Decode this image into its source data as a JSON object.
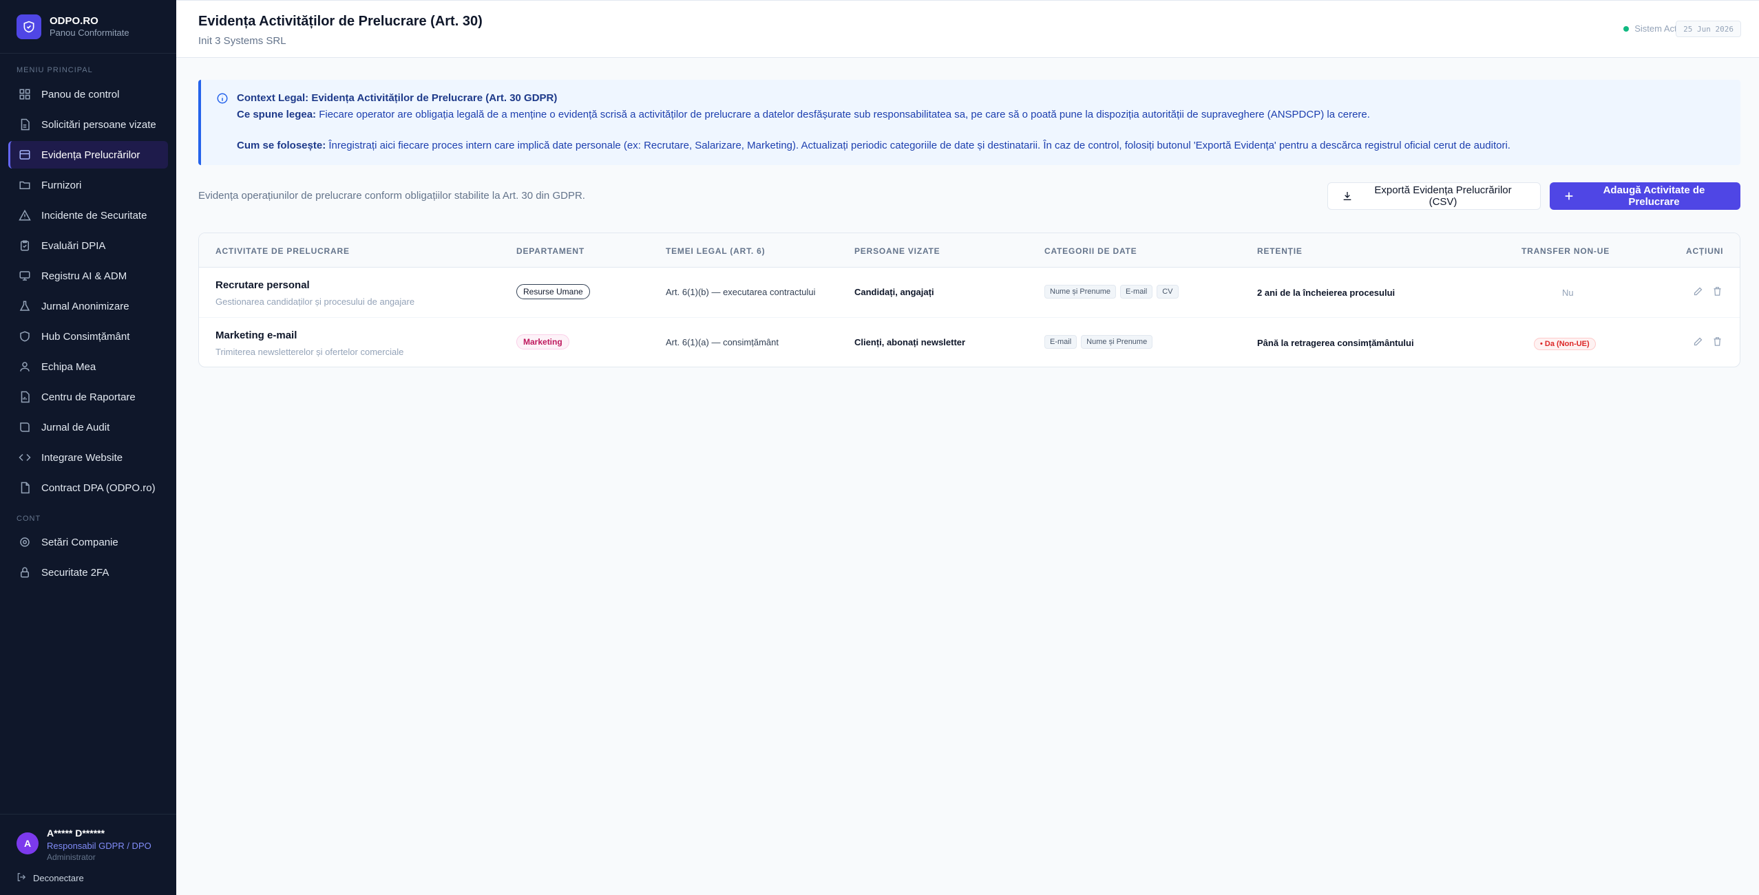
{
  "brand": {
    "name": "ODPO.RO",
    "subtitle": "Panou Conformitate"
  },
  "sidebar": {
    "main_label": "Meniu Principal",
    "items": [
      {
        "label": "Panou de control",
        "icon": "dashboard-icon"
      },
      {
        "label": "Solicitări persoane vizate",
        "icon": "file-icon"
      },
      {
        "label": "Evidența Prelucrărilor",
        "icon": "database-icon",
        "active": true
      },
      {
        "label": "Furnizori",
        "icon": "folder-icon"
      },
      {
        "label": "Incidente de Securitate",
        "icon": "warning-icon"
      },
      {
        "label": "Evaluări DPIA",
        "icon": "clipboard-icon"
      },
      {
        "label": "Registru AI & ADM",
        "icon": "monitor-icon"
      },
      {
        "label": "Jurnal Anonimizare",
        "icon": "flask-icon"
      },
      {
        "label": "Hub Consimțământ",
        "icon": "shield-icon"
      },
      {
        "label": "Echipa Mea",
        "icon": "users-icon"
      },
      {
        "label": "Centru de Raportare",
        "icon": "report-icon"
      },
      {
        "label": "Jurnal de Audit",
        "icon": "book-icon"
      },
      {
        "label": "Integrare Website",
        "icon": "code-icon"
      },
      {
        "label": "Contract DPA (ODPO.ro)",
        "icon": "document-icon"
      }
    ],
    "account_label": "Cont",
    "account_items": [
      {
        "label": "Setări Companie",
        "icon": "gear-icon"
      },
      {
        "label": "Securitate 2FA",
        "icon": "lock-icon"
      }
    ]
  },
  "user": {
    "initial": "A",
    "name": "A***** D******",
    "role": "Responsabil GDPR / DPO",
    "level": "Administrator",
    "logout": "Deconectare"
  },
  "header": {
    "title": "Evidența Activităților de Prelucrare (Art. 30)",
    "company": "Init 3 Systems SRL",
    "status": "Sistem Activ",
    "date": "25 Jun 2026"
  },
  "info": {
    "title": "Context Legal: Evidența Activităților de Prelucrare (Art. 30 GDPR)",
    "p1_label": "Ce spune legea:",
    "p1_text": " Fiecare operator are obligația legală de a menține o evidență scrisă a activităților de prelucrare a datelor desfășurate sub responsabilitatea sa, pe care să o poată pune la dispoziția autorității de supraveghere (ANSPDCP) la cerere.",
    "p2_label": "Cum se folosește:",
    "p2_text": " Înregistrați aici fiecare proces intern care implică date personale (ex: Recrutare, Salarizare, Marketing). Actualizați periodic categoriile de date și destinatarii. În caz de control, folosiți butonul 'Exportă Evidența' pentru a descărca registrul oficial cerut de auditori."
  },
  "intro": "Evidența operațiunilor de prelucrare conform obligațiilor stabilite la Art. 30 din GDPR.",
  "buttons": {
    "export": "Exportă Evidența Prelucrărilor (CSV)",
    "add": "Adaugă Activitate de Prelucrare"
  },
  "table": {
    "columns": [
      "Activitate de Prelucrare",
      "Departament",
      "Temei Legal (Art. 6)",
      "Persoane Vizate",
      "Categorii de Date",
      "Retenție",
      "Transfer Non-UE",
      "Acțiuni"
    ],
    "rows": [
      {
        "name": "Recrutare personal",
        "description": "Gestionarea candidaților și procesului de angajare",
        "department": "Resurse Umane",
        "legal_basis": "Art. 6(1)(b) — executarea contractului",
        "subjects": "Candidați, angajați",
        "categories": [
          "Nume și Prenume",
          "E-mail",
          "CV"
        ],
        "retention": "2 ani de la încheierea procesului",
        "transfer": "Nu"
      },
      {
        "name": "Marketing e-mail",
        "description": "Trimiterea newsletterelor și ofertelor comerciale",
        "department": "Marketing",
        "legal_basis": "Art. 6(1)(a) — consimțământ",
        "subjects": "Clienți, abonați newsletter",
        "categories": [
          "E-mail",
          "Nume și Prenume"
        ],
        "retention": "Până la retragerea consimțământului",
        "transfer": "• Da (Non-UE)"
      }
    ]
  }
}
